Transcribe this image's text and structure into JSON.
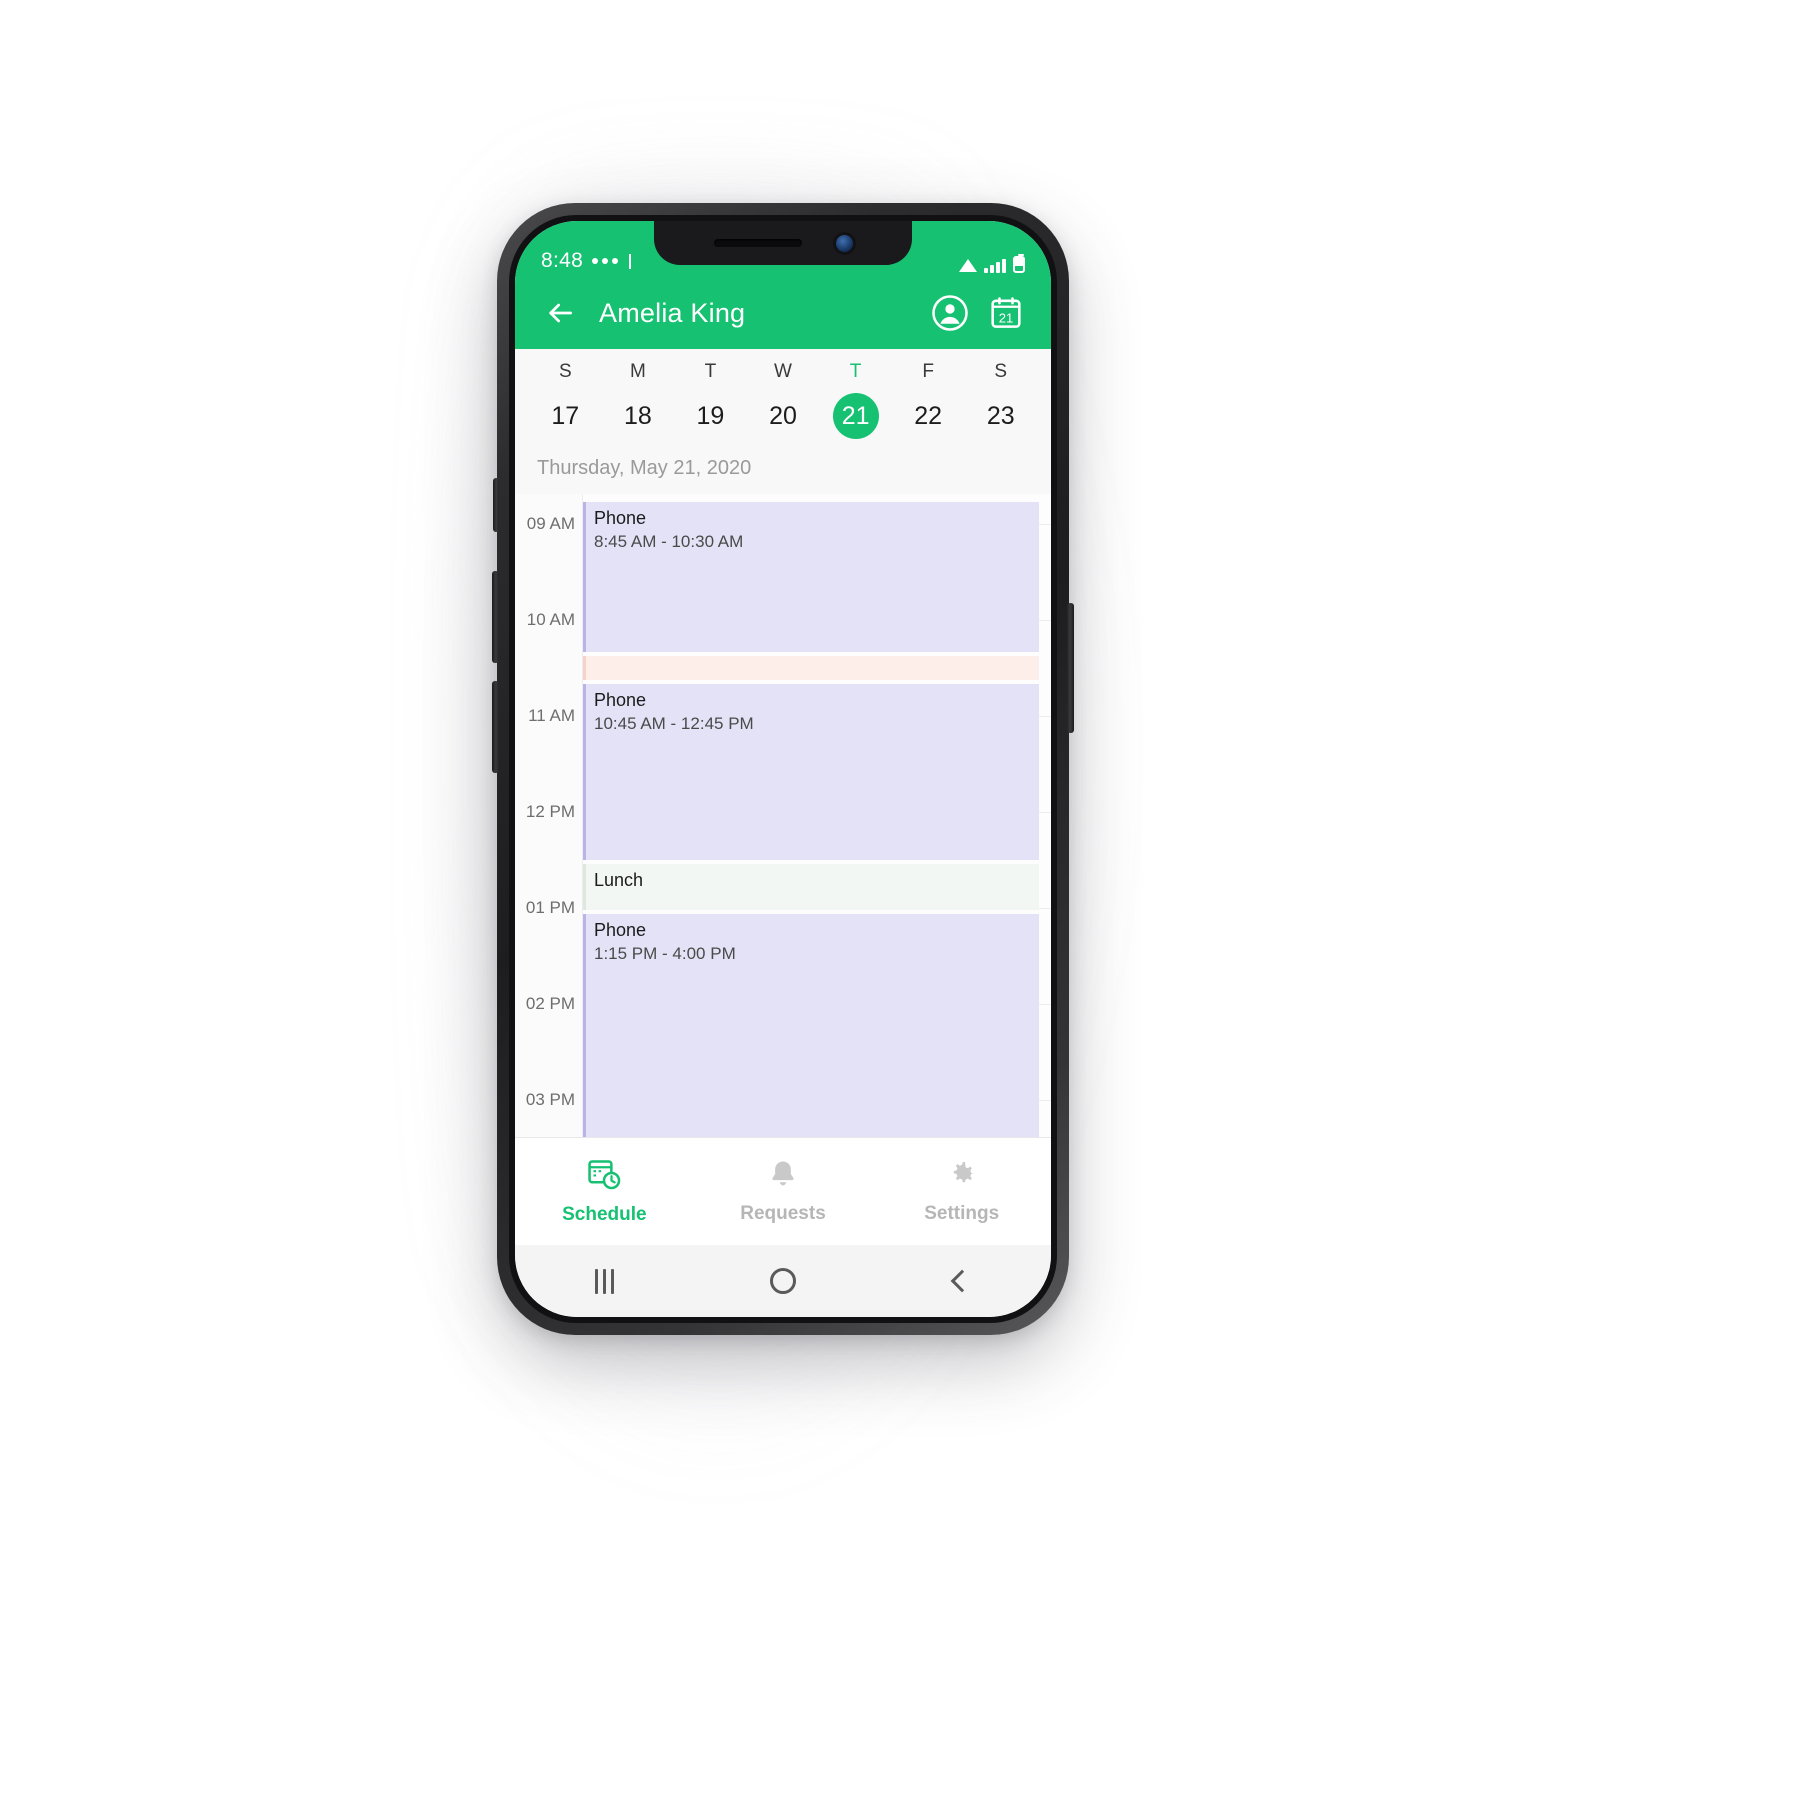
{
  "statusbar": {
    "time": "8:48",
    "dots_icon": "more-dots-icon",
    "signal_icon": "signal-bars-icon",
    "battery_icon": "battery-icon",
    "wifi_icon": "wifi-icon"
  },
  "appbar": {
    "back_icon": "back-arrow-icon",
    "title": "Amelia King",
    "profile_icon": "account-circle-icon",
    "calendar_icon": "calendar-21-icon",
    "calendar_day": "21",
    "accent_color": "#16c172"
  },
  "weekstrip": {
    "days": [
      {
        "dow": "S",
        "num": "17",
        "active": false
      },
      {
        "dow": "M",
        "num": "18",
        "active": false
      },
      {
        "dow": "T",
        "num": "19",
        "active": false
      },
      {
        "dow": "W",
        "num": "20",
        "active": false
      },
      {
        "dow": "T",
        "num": "21",
        "active": true
      },
      {
        "dow": "F",
        "num": "22",
        "active": false
      },
      {
        "dow": "S",
        "num": "23",
        "active": false
      }
    ]
  },
  "agenda": {
    "date_label": "Thursday, May 21, 2020",
    "hours": [
      "09 AM",
      "10 AM",
      "11 AM",
      "12 PM",
      "01 PM",
      "02 PM",
      "03 PM"
    ],
    "events": [
      {
        "title": "Phone",
        "time": "8:45 AM - 10:30 AM",
        "kind": "appointment",
        "color": "#e4e2f6"
      },
      {
        "title": "",
        "time": "",
        "kind": "break",
        "color": "#fdeeea"
      },
      {
        "title": "Phone",
        "time": "10:45 AM - 12:45 PM",
        "kind": "appointment",
        "color": "#e4e2f6"
      },
      {
        "title": "Lunch",
        "time": "",
        "kind": "lunch",
        "color": "#f3f7f3"
      },
      {
        "title": "Phone",
        "time": "1:15 PM - 4:00 PM",
        "kind": "appointment",
        "color": "#e4e2f6"
      }
    ]
  },
  "bottomnav": {
    "items": [
      {
        "label": "Schedule",
        "icon": "schedule-calendar-clock-icon",
        "active": true
      },
      {
        "label": "Requests",
        "icon": "bell-icon",
        "active": false
      },
      {
        "label": "Settings",
        "icon": "gear-icon",
        "active": false
      }
    ]
  },
  "sysbar": {
    "recent_icon": "recent-apps-icon",
    "home_icon": "home-icon",
    "back_icon": "system-back-icon"
  }
}
